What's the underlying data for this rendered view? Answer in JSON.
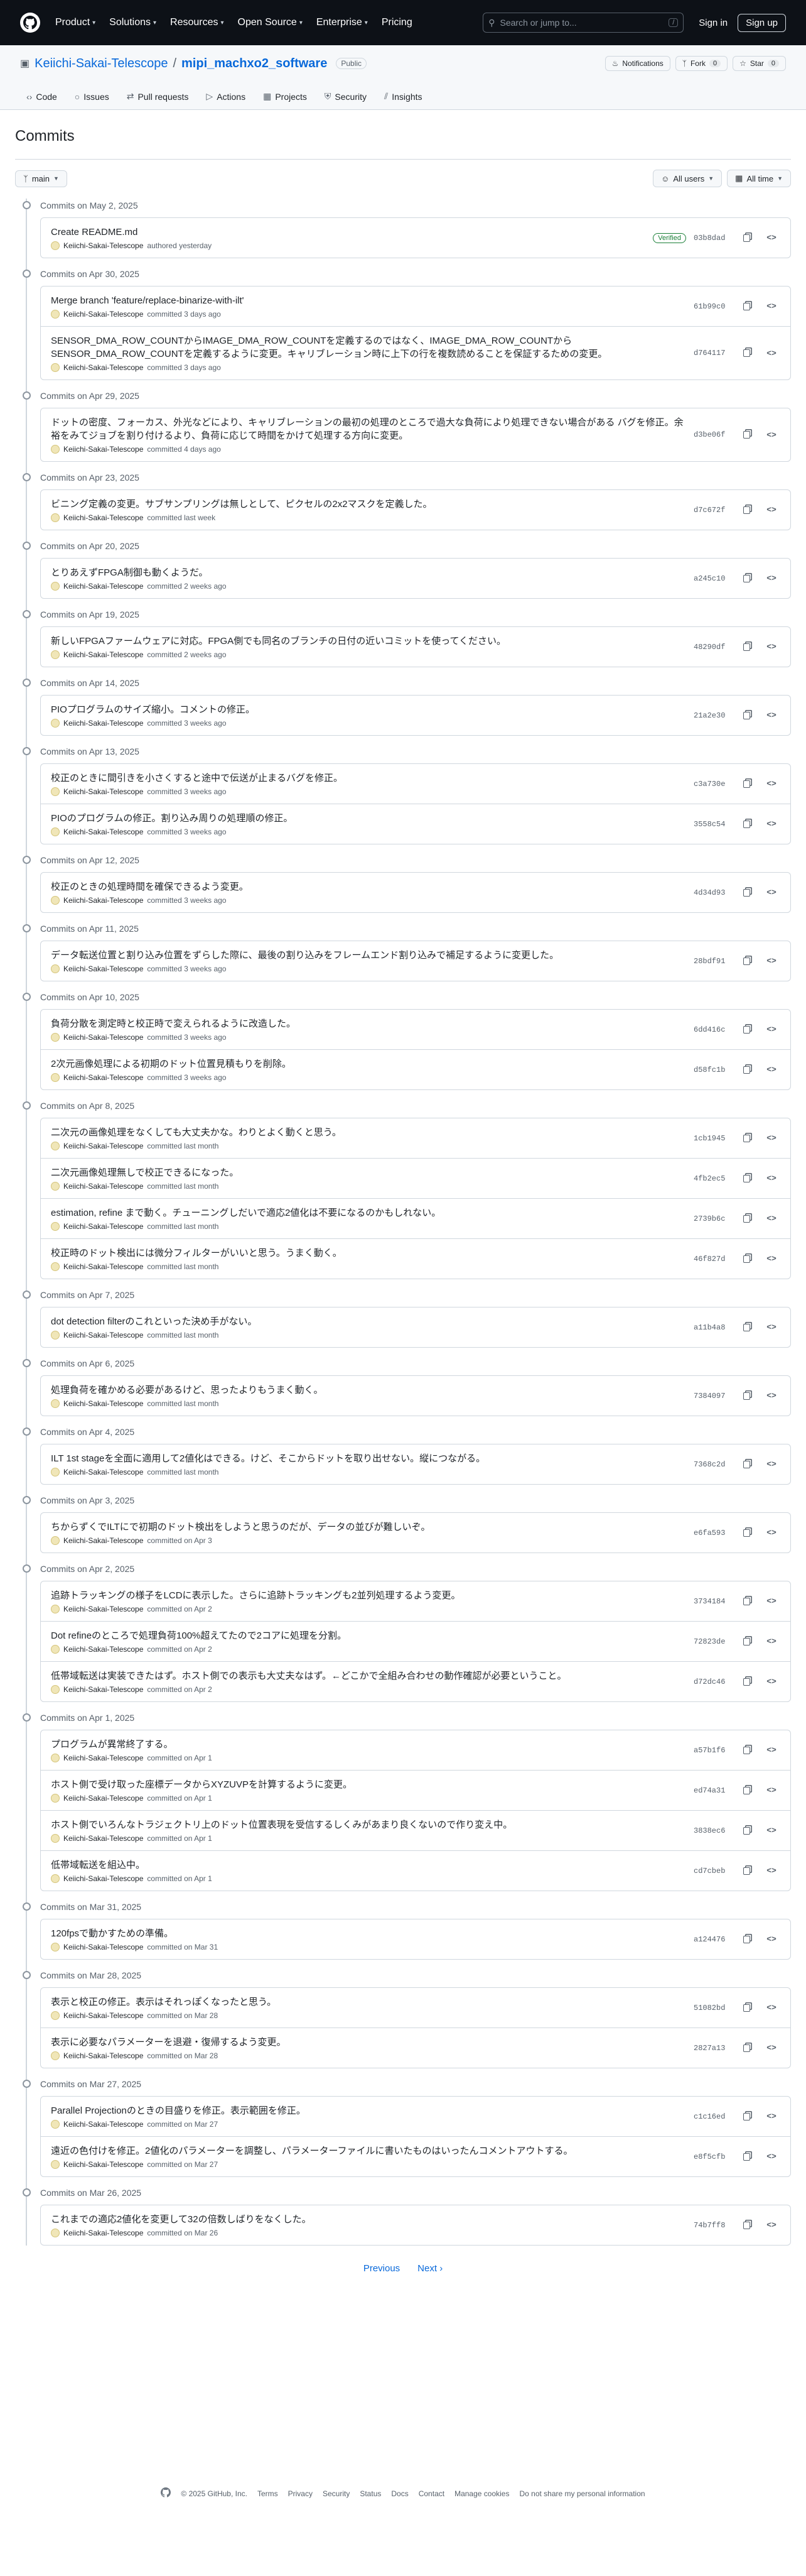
{
  "header": {
    "nav": [
      "Product",
      "Solutions",
      "Resources",
      "Open Source",
      "Enterprise",
      "Pricing"
    ],
    "search_placeholder": "Search or jump to...",
    "search_shortcut": "/",
    "sign_in": "Sign in",
    "sign_up": "Sign up"
  },
  "repo": {
    "owner": "Keiichi-Sakai-Telescope",
    "separator": "/",
    "name": "mipi_machxo2_software",
    "visibility": "Public",
    "notifications": "Notifications",
    "fork_label": "Fork",
    "fork_count": "0",
    "star_label": "Star",
    "star_count": "0",
    "tabs": [
      "Code",
      "Issues",
      "Pull requests",
      "Actions",
      "Projects",
      "Security",
      "Insights"
    ]
  },
  "page": {
    "title": "Commits",
    "branch": "main",
    "users_filter": "All users",
    "time_filter": "All time"
  },
  "groups": [
    {
      "date": "Commits on May 2, 2025",
      "commits": [
        {
          "msg": "Create README.md",
          "author": "Keiichi-Sakai-Telescope",
          "when": "authored yesterday",
          "sha": "03b8dad",
          "verified": "Verified"
        }
      ]
    },
    {
      "date": "Commits on Apr 30, 2025",
      "commits": [
        {
          "msg": "Merge branch 'feature/replace-binarize-with-ilt'",
          "author": "Keiichi-Sakai-Telescope",
          "when": "committed 3 days ago",
          "sha": "61b99c0"
        },
        {
          "msg": "SENSOR_DMA_ROW_COUNTからIMAGE_DMA_ROW_COUNTを定義するのではなく、IMAGE_DMA_ROW_COUNTから SENSOR_DMA_ROW_COUNTを定義するように変更。キャリブレーション時に上下の行を複数読めることを保証するための変更。",
          "author": "Keiichi-Sakai-Telescope",
          "when": "committed 3 days ago",
          "sha": "d764117"
        }
      ]
    },
    {
      "date": "Commits on Apr 29, 2025",
      "commits": [
        {
          "msg": "ドットの密度、フォーカス、外光などにより、キャリブレーションの最初の処理のところで過大な負荷により処理できない場合がある バグを修正。余裕をみてジョブを割り付けるより、負荷に応じて時間をかけて処理する方向に変更。",
          "author": "Keiichi-Sakai-Telescope",
          "when": "committed 4 days ago",
          "sha": "d3be06f"
        }
      ]
    },
    {
      "date": "Commits on Apr 23, 2025",
      "commits": [
        {
          "msg": "ビニング定義の変更。サブサンプリングは無しとして、ピクセルの2x2マスクを定義した。",
          "author": "Keiichi-Sakai-Telescope",
          "when": "committed last week",
          "sha": "d7c672f"
        }
      ]
    },
    {
      "date": "Commits on Apr 20, 2025",
      "commits": [
        {
          "msg": "とりあえずFPGA制御も動くようだ。",
          "author": "Keiichi-Sakai-Telescope",
          "when": "committed 2 weeks ago",
          "sha": "a245c10"
        }
      ]
    },
    {
      "date": "Commits on Apr 19, 2025",
      "commits": [
        {
          "msg": "新しいFPGAファームウェアに対応。FPGA側でも同名のブランチの日付の近いコミットを使ってください。",
          "author": "Keiichi-Sakai-Telescope",
          "when": "committed 2 weeks ago",
          "sha": "48290df"
        }
      ]
    },
    {
      "date": "Commits on Apr 14, 2025",
      "commits": [
        {
          "msg": "PIOプログラムのサイズ縮小。コメントの修正。",
          "author": "Keiichi-Sakai-Telescope",
          "when": "committed 3 weeks ago",
          "sha": "21a2e30"
        }
      ]
    },
    {
      "date": "Commits on Apr 13, 2025",
      "commits": [
        {
          "msg": "校正のときに間引きを小さくすると途中で伝送が止まるバグを修正。",
          "author": "Keiichi-Sakai-Telescope",
          "when": "committed 3 weeks ago",
          "sha": "c3a730e"
        },
        {
          "msg": "PIOのプログラムの修正。割り込み周りの処理順の修正。",
          "author": "Keiichi-Sakai-Telescope",
          "when": "committed 3 weeks ago",
          "sha": "3558c54"
        }
      ]
    },
    {
      "date": "Commits on Apr 12, 2025",
      "commits": [
        {
          "msg": "校正のときの処理時間を確保できるよう変更。",
          "author": "Keiichi-Sakai-Telescope",
          "when": "committed 3 weeks ago",
          "sha": "4d34d93"
        }
      ]
    },
    {
      "date": "Commits on Apr 11, 2025",
      "commits": [
        {
          "msg": "データ転送位置と割り込み位置をずらした際に、最後の割り込みをフレームエンド割り込みで補足するように変更した。",
          "author": "Keiichi-Sakai-Telescope",
          "when": "committed 3 weeks ago",
          "sha": "28bdf91"
        }
      ]
    },
    {
      "date": "Commits on Apr 10, 2025",
      "commits": [
        {
          "msg": "負荷分散を測定時と校正時で変えられるように改造した。",
          "author": "Keiichi-Sakai-Telescope",
          "when": "committed 3 weeks ago",
          "sha": "6dd416c"
        },
        {
          "msg": "2次元画像処理による初期のドット位置見積もりを削除。",
          "author": "Keiichi-Sakai-Telescope",
          "when": "committed 3 weeks ago",
          "sha": "d58fc1b"
        }
      ]
    },
    {
      "date": "Commits on Apr 8, 2025",
      "commits": [
        {
          "msg": "二次元の画像処理をなくしても大丈夫かな。わりとよく動くと思う。",
          "author": "Keiichi-Sakai-Telescope",
          "when": "committed last month",
          "sha": "1cb1945"
        },
        {
          "msg": "二次元画像処理無しで校正できるになった。",
          "author": "Keiichi-Sakai-Telescope",
          "when": "committed last month",
          "sha": "4fb2ec5"
        },
        {
          "msg": "estimation, refine まで動く。チューニングしだいで適応2値化は不要になるのかもしれない。",
          "author": "Keiichi-Sakai-Telescope",
          "when": "committed last month",
          "sha": "2739b6c"
        },
        {
          "msg": "校正時のドット検出には微分フィルターがいいと思う。うまく動く。",
          "author": "Keiichi-Sakai-Telescope",
          "when": "committed last month",
          "sha": "46f827d"
        }
      ]
    },
    {
      "date": "Commits on Apr 7, 2025",
      "commits": [
        {
          "msg": "dot detection filterのこれといった決め手がない。",
          "author": "Keiichi-Sakai-Telescope",
          "when": "committed last month",
          "sha": "a11b4a8"
        }
      ]
    },
    {
      "date": "Commits on Apr 6, 2025",
      "commits": [
        {
          "msg": "処理負荷を確かめる必要があるけど、思ったよりもうまく動く。",
          "author": "Keiichi-Sakai-Telescope",
          "when": "committed last month",
          "sha": "7384097"
        }
      ]
    },
    {
      "date": "Commits on Apr 4, 2025",
      "commits": [
        {
          "msg": "ILT 1st stageを全面に適用して2値化はできる。けど、そこからドットを取り出せない。縦につながる。",
          "author": "Keiichi-Sakai-Telescope",
          "when": "committed last month",
          "sha": "7368c2d"
        }
      ]
    },
    {
      "date": "Commits on Apr 3, 2025",
      "commits": [
        {
          "msg": "ちからずくでILTにで初期のドット検出をしようと思うのだが、データの並びが難しいぞ。",
          "author": "Keiichi-Sakai-Telescope",
          "when": "committed on Apr 3",
          "sha": "e6fa593"
        }
      ]
    },
    {
      "date": "Commits on Apr 2, 2025",
      "commits": [
        {
          "msg": "追跡トラッキングの様子をLCDに表示した。さらに追跡トラッキングも2並列処理するよう変更。",
          "author": "Keiichi-Sakai-Telescope",
          "when": "committed on Apr 2",
          "sha": "3734184"
        },
        {
          "msg": "Dot refineのところで処理負荷100%超えてたので2コアに処理を分割。",
          "author": "Keiichi-Sakai-Telescope",
          "when": "committed on Apr 2",
          "sha": "72823de"
        },
        {
          "msg": "低帯域転送は実装できたはず。ホスト側での表示も大丈夫なはず。←どこかで全組み合わせの動作確認が必要ということ。",
          "author": "Keiichi-Sakai-Telescope",
          "when": "committed on Apr 2",
          "sha": "d72dc46"
        }
      ]
    },
    {
      "date": "Commits on Apr 1, 2025",
      "commits": [
        {
          "msg": "プログラムが異常終了する。",
          "author": "Keiichi-Sakai-Telescope",
          "when": "committed on Apr 1",
          "sha": "a57b1f6"
        },
        {
          "msg": "ホスト側で受け取った座標データからXYZUVPを計算するように変更。",
          "author": "Keiichi-Sakai-Telescope",
          "when": "committed on Apr 1",
          "sha": "ed74a31"
        },
        {
          "msg": "ホスト側でいろんなトラジェクトリ上のドット位置表現を受信するしくみがあまり良くないので作り変え中。",
          "author": "Keiichi-Sakai-Telescope",
          "when": "committed on Apr 1",
          "sha": "3838ec6"
        },
        {
          "msg": "低帯域転送を組込中。",
          "author": "Keiichi-Sakai-Telescope",
          "when": "committed on Apr 1",
          "sha": "cd7cbeb"
        }
      ]
    },
    {
      "date": "Commits on Mar 31, 2025",
      "commits": [
        {
          "msg": "120fpsで動かすための準備。",
          "author": "Keiichi-Sakai-Telescope",
          "when": "committed on Mar 31",
          "sha": "a124476"
        }
      ]
    },
    {
      "date": "Commits on Mar 28, 2025",
      "commits": [
        {
          "msg": "表示と校正の修正。表示はそれっぽくなったと思う。",
          "author": "Keiichi-Sakai-Telescope",
          "when": "committed on Mar 28",
          "sha": "51082bd"
        },
        {
          "msg": "表示に必要なパラメーターを退避・復帰するよう変更。",
          "author": "Keiichi-Sakai-Telescope",
          "when": "committed on Mar 28",
          "sha": "2827a13"
        }
      ]
    },
    {
      "date": "Commits on Mar 27, 2025",
      "commits": [
        {
          "msg": "Parallel Projectionのときの目盛りを修正。表示範囲を修正。",
          "author": "Keiichi-Sakai-Telescope",
          "when": "committed on Mar 27",
          "sha": "c1c16ed"
        },
        {
          "msg": "遠近の色付けを修正。2値化のパラメーターを調整し、パラメーターファイルに書いたものはいったんコメントアウトする。",
          "author": "Keiichi-Sakai-Telescope",
          "when": "committed on Mar 27",
          "sha": "e8f5cfb"
        }
      ]
    },
    {
      "date": "Commits on Mar 26, 2025",
      "commits": [
        {
          "msg": "これまでの適応2値化を変更して32の倍数しばりをなくした。",
          "author": "Keiichi-Sakai-Telescope",
          "when": "committed on Mar 26",
          "sha": "74b7ff8"
        }
      ]
    }
  ],
  "pagination": {
    "previous": "Previous",
    "next": "Next"
  },
  "footer": {
    "copyright": "© 2025 GitHub, Inc.",
    "links": [
      "Terms",
      "Privacy",
      "Security",
      "Status",
      "Docs",
      "Contact",
      "Manage cookies",
      "Do not share my personal information"
    ]
  }
}
